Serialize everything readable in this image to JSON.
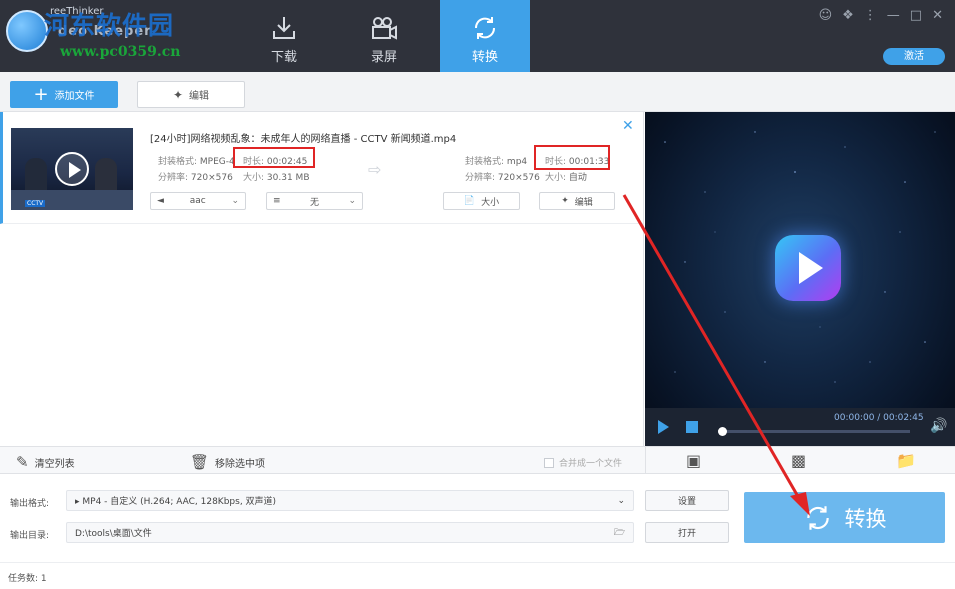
{
  "logo": {
    "brand_small": "reeThinker",
    "brand_sub": "deo Keeper",
    "watermark_cn": "河东软件园",
    "watermark_url": "www.pc0359.cn"
  },
  "nav": {
    "download": "下载",
    "record": "录屏",
    "convert": "转换"
  },
  "register_label": "激活",
  "toolbar": {
    "add_files": "添加文件",
    "edit": "编辑"
  },
  "file": {
    "name": "[24小时]网络视频乱象：未成年人的网络直播 - CCTV 新闻频道.mp4",
    "thumb_badge": "CCTV",
    "src": {
      "format_label": "封装格式:",
      "format": "MPEG-4",
      "duration_label": "时长:",
      "duration": "00:02:45",
      "resolution_label": "分辨率:",
      "resolution": "720×576",
      "size_label": "大小:",
      "size": "30.31 MB"
    },
    "dst": {
      "format_label": "封装格式:",
      "format": "mp4",
      "duration_label": "时长:",
      "duration": "00:01:33",
      "resolution_label": "分辨率:",
      "resolution": "720×576",
      "size_label": "大小:",
      "size": "自动"
    },
    "audio_select": "aac",
    "subtitle_select": "无",
    "size_button": "大小",
    "edit_button": "编辑"
  },
  "player": {
    "time": "00:00:00 / 00:02:45"
  },
  "actions": {
    "clear_list": "清空列表",
    "remove_selected": "移除选中项",
    "merge": "合并成一个文件"
  },
  "output": {
    "format_label": "输出格式:",
    "format_value": "MP4 - 自定义 (H.264; AAC, 128Kbps, 双声道)",
    "settings_button": "设置",
    "dir_label": "输出目录:",
    "dir_value": "D:\\tools\\桌面\\文件",
    "open_button": "打开",
    "convert_button": "转换"
  },
  "status": {
    "task_count": "任务数: 1"
  },
  "colors": {
    "accent": "#3fa1e8",
    "header_bg": "#2f323b",
    "annotation": "#e02525",
    "convert_btn": "#6cb8ee"
  }
}
